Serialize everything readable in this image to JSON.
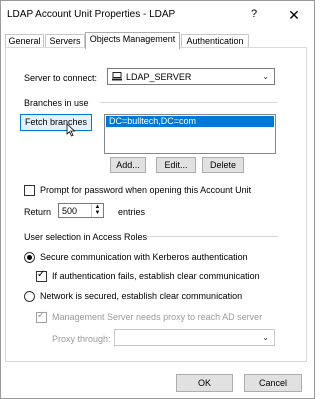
{
  "window": {
    "title": "LDAP Account Unit Properties - LDAP",
    "help": "?",
    "close": "✕"
  },
  "tabs": [
    "General",
    "Servers",
    "Objects Management",
    "Authentication"
  ],
  "server": {
    "label": "Server to connect:",
    "value": "LDAP_SERVER"
  },
  "branches": {
    "label": "Branches in use",
    "fetch": "Fetch branches",
    "items": [
      "DC=bulltech,DC=com"
    ],
    "add": "Add...",
    "edit": "Edit...",
    "delete": "Delete"
  },
  "prompt": {
    "label": "Prompt for password when opening this Account Unit",
    "checked": false
  },
  "return": {
    "label": "Return",
    "value": "500",
    "suffix": "entries"
  },
  "access": {
    "title": "User selection in Access Roles",
    "secure": "Secure communication with Kerberos authentication",
    "fallback": "If authentication fails, establish clear communication",
    "network": "Network is secured, establish clear communication",
    "proxy": "Management Server needs proxy to reach AD server",
    "proxy_through": "Proxy through:"
  },
  "footer": {
    "ok": "OK",
    "cancel": "Cancel"
  }
}
